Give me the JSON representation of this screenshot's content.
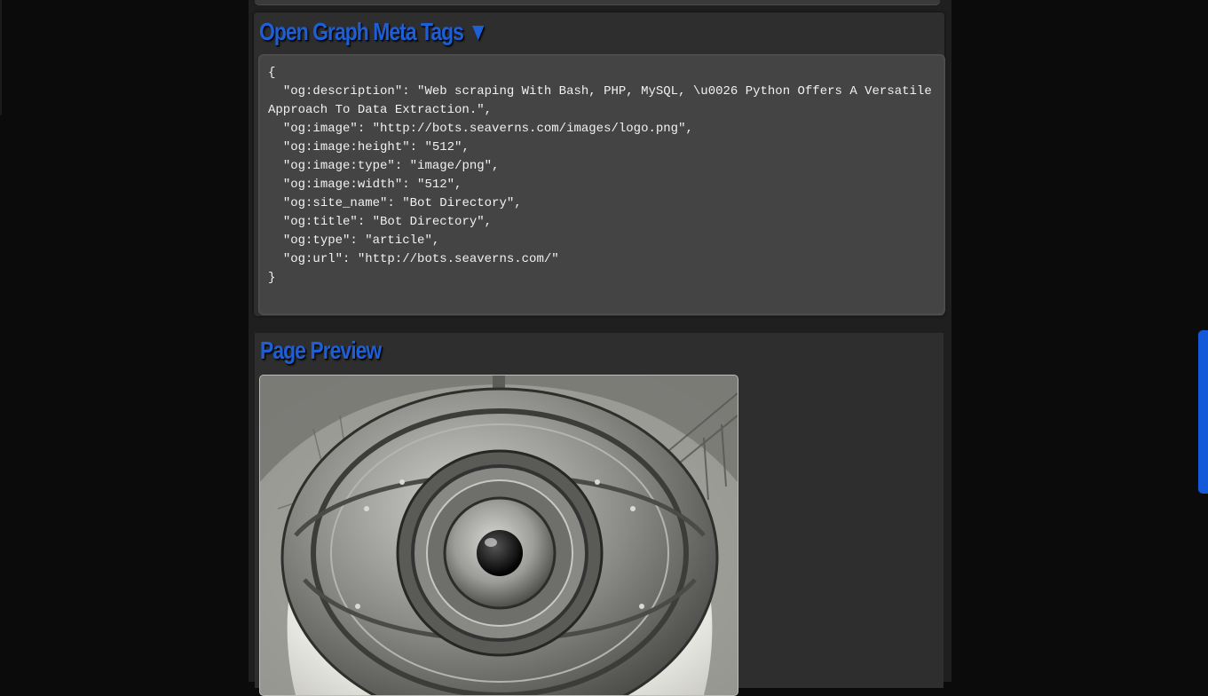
{
  "og_section": {
    "title": "Open Graph Meta Tags ▼",
    "code": "{\n  \"og:description\": \"Web scraping With Bash, PHP, MySQL, \\u0026 Python Offers A Versatile Approach To Data Extraction.\",\n  \"og:image\": \"http://bots.seaverns.com/images/logo.png\",\n  \"og:image:height\": \"512\",\n  \"og:image:type\": \"image/png\",\n  \"og:image:width\": \"512\",\n  \"og:site_name\": \"Bot Directory\",\n  \"og:title\": \"Bot Directory\",\n  \"og:type\": \"article\",\n  \"og:url\": \"http://bots.seaverns.com/\"\n}"
  },
  "preview_section": {
    "title": "Page Preview"
  },
  "colors": {
    "accent": "#1f5fd6",
    "scrollbar": "#1459d9",
    "panel": "#2e2e2e",
    "code_bg": "#444444",
    "page_bg": "#0b0b0b"
  }
}
